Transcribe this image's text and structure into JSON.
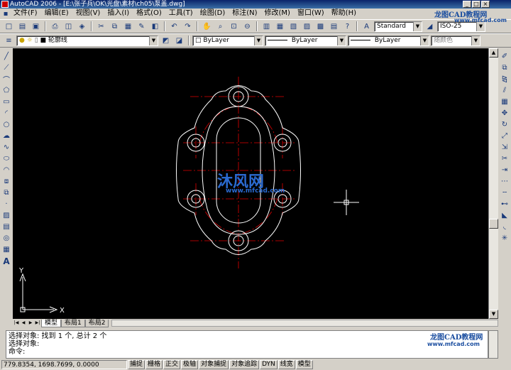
{
  "window": {
    "title": "AutoCAD 2006 - [E:\\张子兵\\OK\\光盘\\素材\\ch05\\泵盖.dwg]",
    "minimize": "_",
    "maximize": "□",
    "close": "×"
  },
  "menu": [
    "文件(F)",
    "编辑(E)",
    "视图(V)",
    "插入(I)",
    "格式(O)",
    "工具(T)",
    "绘图(D)",
    "标注(N)",
    "修改(M)",
    "窗口(W)",
    "帮助(H)"
  ],
  "toolbar": {
    "text_style": "Standard",
    "dim_style": "ISO-25",
    "layer": "轮廓线",
    "color": "ByLayer",
    "linetype": "ByLayer",
    "lineweight": "ByLayer",
    "plot_style": "随颜色"
  },
  "canvas": {
    "background": "#000000",
    "outline_color": "#ffffff",
    "centerline_color": "#e00000",
    "ucs_x": "X",
    "ucs_y": "Y",
    "watermark_cn": "沐风网",
    "watermark_url": "www.mfcad.com"
  },
  "tabs": [
    "模型",
    "布局1",
    "布局2"
  ],
  "command": {
    "lines": [
      "选择对象: 找到 1 个, 总计 2 个",
      "选择对象:"
    ],
    "prompt": "命令:"
  },
  "status": {
    "coords": "779.8354, 1698.7699, 0.0000",
    "toggles": [
      "捕捉",
      "栅格",
      "正交",
      "极轴",
      "对象捕捉",
      "对象追踪",
      "DYN",
      "线宽",
      "模型"
    ]
  },
  "branding": {
    "logo_text": "龙图CAD教程网",
    "logo_url": "www.mfcad.com"
  }
}
